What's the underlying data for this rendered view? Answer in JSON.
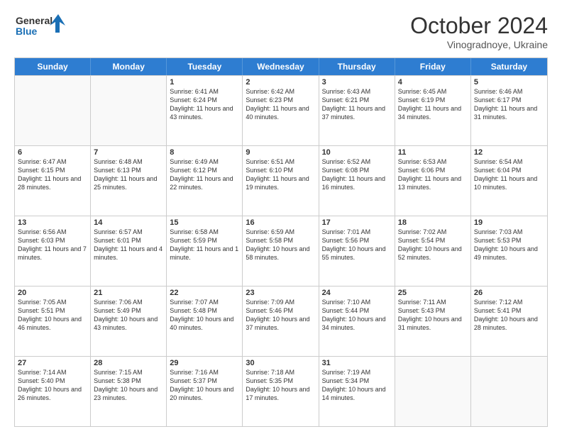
{
  "header": {
    "logo_line1": "General",
    "logo_line2": "Blue",
    "month": "October 2024",
    "location": "Vinogradnoye, Ukraine"
  },
  "days_of_week": [
    "Sunday",
    "Monday",
    "Tuesday",
    "Wednesday",
    "Thursday",
    "Friday",
    "Saturday"
  ],
  "rows": [
    [
      {
        "day": "",
        "sunrise": "",
        "sunset": "",
        "daylight": "",
        "empty": true
      },
      {
        "day": "",
        "sunrise": "",
        "sunset": "",
        "daylight": "",
        "empty": true
      },
      {
        "day": "1",
        "sunrise": "Sunrise: 6:41 AM",
        "sunset": "Sunset: 6:24 PM",
        "daylight": "Daylight: 11 hours and 43 minutes."
      },
      {
        "day": "2",
        "sunrise": "Sunrise: 6:42 AM",
        "sunset": "Sunset: 6:23 PM",
        "daylight": "Daylight: 11 hours and 40 minutes."
      },
      {
        "day": "3",
        "sunrise": "Sunrise: 6:43 AM",
        "sunset": "Sunset: 6:21 PM",
        "daylight": "Daylight: 11 hours and 37 minutes."
      },
      {
        "day": "4",
        "sunrise": "Sunrise: 6:45 AM",
        "sunset": "Sunset: 6:19 PM",
        "daylight": "Daylight: 11 hours and 34 minutes."
      },
      {
        "day": "5",
        "sunrise": "Sunrise: 6:46 AM",
        "sunset": "Sunset: 6:17 PM",
        "daylight": "Daylight: 11 hours and 31 minutes."
      }
    ],
    [
      {
        "day": "6",
        "sunrise": "Sunrise: 6:47 AM",
        "sunset": "Sunset: 6:15 PM",
        "daylight": "Daylight: 11 hours and 28 minutes."
      },
      {
        "day": "7",
        "sunrise": "Sunrise: 6:48 AM",
        "sunset": "Sunset: 6:13 PM",
        "daylight": "Daylight: 11 hours and 25 minutes."
      },
      {
        "day": "8",
        "sunrise": "Sunrise: 6:49 AM",
        "sunset": "Sunset: 6:12 PM",
        "daylight": "Daylight: 11 hours and 22 minutes."
      },
      {
        "day": "9",
        "sunrise": "Sunrise: 6:51 AM",
        "sunset": "Sunset: 6:10 PM",
        "daylight": "Daylight: 11 hours and 19 minutes."
      },
      {
        "day": "10",
        "sunrise": "Sunrise: 6:52 AM",
        "sunset": "Sunset: 6:08 PM",
        "daylight": "Daylight: 11 hours and 16 minutes."
      },
      {
        "day": "11",
        "sunrise": "Sunrise: 6:53 AM",
        "sunset": "Sunset: 6:06 PM",
        "daylight": "Daylight: 11 hours and 13 minutes."
      },
      {
        "day": "12",
        "sunrise": "Sunrise: 6:54 AM",
        "sunset": "Sunset: 6:04 PM",
        "daylight": "Daylight: 11 hours and 10 minutes."
      }
    ],
    [
      {
        "day": "13",
        "sunrise": "Sunrise: 6:56 AM",
        "sunset": "Sunset: 6:03 PM",
        "daylight": "Daylight: 11 hours and 7 minutes."
      },
      {
        "day": "14",
        "sunrise": "Sunrise: 6:57 AM",
        "sunset": "Sunset: 6:01 PM",
        "daylight": "Daylight: 11 hours and 4 minutes."
      },
      {
        "day": "15",
        "sunrise": "Sunrise: 6:58 AM",
        "sunset": "Sunset: 5:59 PM",
        "daylight": "Daylight: 11 hours and 1 minute."
      },
      {
        "day": "16",
        "sunrise": "Sunrise: 6:59 AM",
        "sunset": "Sunset: 5:58 PM",
        "daylight": "Daylight: 10 hours and 58 minutes."
      },
      {
        "day": "17",
        "sunrise": "Sunrise: 7:01 AM",
        "sunset": "Sunset: 5:56 PM",
        "daylight": "Daylight: 10 hours and 55 minutes."
      },
      {
        "day": "18",
        "sunrise": "Sunrise: 7:02 AM",
        "sunset": "Sunset: 5:54 PM",
        "daylight": "Daylight: 10 hours and 52 minutes."
      },
      {
        "day": "19",
        "sunrise": "Sunrise: 7:03 AM",
        "sunset": "Sunset: 5:53 PM",
        "daylight": "Daylight: 10 hours and 49 minutes."
      }
    ],
    [
      {
        "day": "20",
        "sunrise": "Sunrise: 7:05 AM",
        "sunset": "Sunset: 5:51 PM",
        "daylight": "Daylight: 10 hours and 46 minutes."
      },
      {
        "day": "21",
        "sunrise": "Sunrise: 7:06 AM",
        "sunset": "Sunset: 5:49 PM",
        "daylight": "Daylight: 10 hours and 43 minutes."
      },
      {
        "day": "22",
        "sunrise": "Sunrise: 7:07 AM",
        "sunset": "Sunset: 5:48 PM",
        "daylight": "Daylight: 10 hours and 40 minutes."
      },
      {
        "day": "23",
        "sunrise": "Sunrise: 7:09 AM",
        "sunset": "Sunset: 5:46 PM",
        "daylight": "Daylight: 10 hours and 37 minutes."
      },
      {
        "day": "24",
        "sunrise": "Sunrise: 7:10 AM",
        "sunset": "Sunset: 5:44 PM",
        "daylight": "Daylight: 10 hours and 34 minutes."
      },
      {
        "day": "25",
        "sunrise": "Sunrise: 7:11 AM",
        "sunset": "Sunset: 5:43 PM",
        "daylight": "Daylight: 10 hours and 31 minutes."
      },
      {
        "day": "26",
        "sunrise": "Sunrise: 7:12 AM",
        "sunset": "Sunset: 5:41 PM",
        "daylight": "Daylight: 10 hours and 28 minutes."
      }
    ],
    [
      {
        "day": "27",
        "sunrise": "Sunrise: 7:14 AM",
        "sunset": "Sunset: 5:40 PM",
        "daylight": "Daylight: 10 hours and 26 minutes."
      },
      {
        "day": "28",
        "sunrise": "Sunrise: 7:15 AM",
        "sunset": "Sunset: 5:38 PM",
        "daylight": "Daylight: 10 hours and 23 minutes."
      },
      {
        "day": "29",
        "sunrise": "Sunrise: 7:16 AM",
        "sunset": "Sunset: 5:37 PM",
        "daylight": "Daylight: 10 hours and 20 minutes."
      },
      {
        "day": "30",
        "sunrise": "Sunrise: 7:18 AM",
        "sunset": "Sunset: 5:35 PM",
        "daylight": "Daylight: 10 hours and 17 minutes."
      },
      {
        "day": "31",
        "sunrise": "Sunrise: 7:19 AM",
        "sunset": "Sunset: 5:34 PM",
        "daylight": "Daylight: 10 hours and 14 minutes."
      },
      {
        "day": "",
        "sunrise": "",
        "sunset": "",
        "daylight": "",
        "empty": true
      },
      {
        "day": "",
        "sunrise": "",
        "sunset": "",
        "daylight": "",
        "empty": true
      }
    ]
  ]
}
